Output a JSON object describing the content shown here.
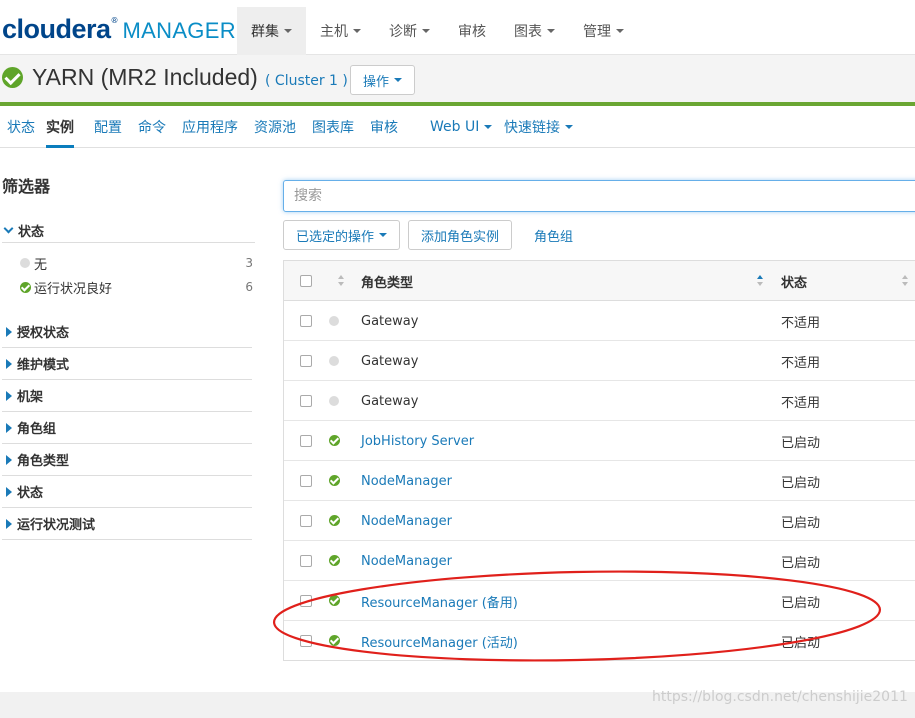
{
  "brand": {
    "name": "cloudera",
    "tm": "®",
    "product": "MANAGER"
  },
  "topnav": [
    {
      "label": "群集",
      "active": true
    },
    {
      "label": "主机",
      "dropdown": true
    },
    {
      "label": "诊断",
      "dropdown": true
    },
    {
      "label": "审核",
      "dropdown": false
    },
    {
      "label": "图表",
      "dropdown": true
    },
    {
      "label": "管理",
      "dropdown": true
    }
  ],
  "service": {
    "title": "YARN (MR2 Included)",
    "cluster": "( Cluster 1 )",
    "actions_label": "操作"
  },
  "subtabs": [
    {
      "label": "状态"
    },
    {
      "label": "实例",
      "active": true
    },
    {
      "label": "配置"
    },
    {
      "label": "命令"
    },
    {
      "label": "应用程序"
    },
    {
      "label": "资源池"
    },
    {
      "label": "图表库"
    },
    {
      "label": "审核"
    },
    {
      "label": "Web UI",
      "dropdown": true
    },
    {
      "label": "快速链接",
      "dropdown": true
    }
  ],
  "filters": {
    "title": "筛选器",
    "status_facet": {
      "label": "状态",
      "items": [
        {
          "label": "无",
          "count": "3",
          "icon": "grey-dot"
        },
        {
          "label": "运行状况良好",
          "count": "6",
          "icon": "green-check"
        }
      ]
    },
    "collapsed_facets": [
      "授权状态",
      "维护模式",
      "机架",
      "角色组",
      "角色类型",
      "状态",
      "运行状况测试"
    ]
  },
  "search": {
    "placeholder": "搜索"
  },
  "toolbar": {
    "selected_actions": "已选定的操作",
    "add_role_instances": "添加角色实例",
    "role_groups": "角色组"
  },
  "table": {
    "columns": {
      "role_type": "角色类型",
      "status": "状态"
    },
    "rows": [
      {
        "role": "Gateway",
        "status": "不适用",
        "health": "none"
      },
      {
        "role": "Gateway",
        "status": "不适用",
        "health": "none"
      },
      {
        "role": "Gateway",
        "status": "不适用",
        "health": "none"
      },
      {
        "role": "JobHistory Server",
        "status": "已启动",
        "health": "good"
      },
      {
        "role": "NodeManager",
        "status": "已启动",
        "health": "good"
      },
      {
        "role": "NodeManager",
        "status": "已启动",
        "health": "good"
      },
      {
        "role": "NodeManager",
        "status": "已启动",
        "health": "good"
      },
      {
        "role": "ResourceManager (备用)",
        "status": "已启动",
        "health": "good"
      },
      {
        "role": "ResourceManager (活动)",
        "status": "已启动",
        "health": "good"
      }
    ]
  },
  "watermark": "https://blog.csdn.net/chenshijie2011",
  "colors": {
    "link": "#1a7ab8",
    "good": "#5fa52a",
    "accent_bar": "#6aa632",
    "annotation": "#e0201b"
  }
}
